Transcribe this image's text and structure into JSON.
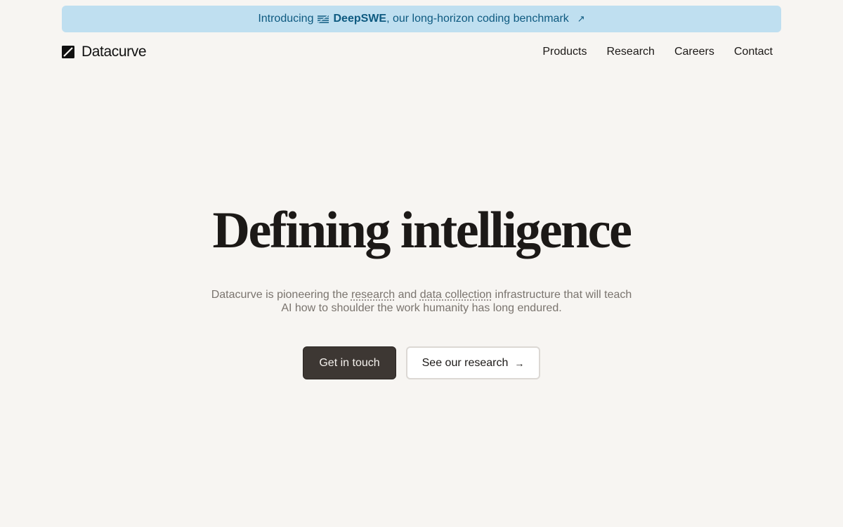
{
  "announcement": {
    "prefix": "Introducing",
    "brand": "DeepSWE",
    "suffix": ", our long-horizon coding benchmark",
    "arrow": "↗"
  },
  "nav": {
    "logo_text": "Datacurve",
    "links": [
      "Products",
      "Research",
      "Careers",
      "Contact"
    ]
  },
  "hero": {
    "title": "Defining intelligence",
    "sub_1": "Datacurve is pioneering the ",
    "sub_link_research": "research",
    "sub_2": " and ",
    "sub_link_data": "data collection",
    "sub_3": " infrastructure that will teach AI how to shoulder the work humanity has long endured.",
    "primary_button": "Get in touch",
    "secondary_button": "See our research",
    "secondary_arrow": "→"
  },
  "colors": {
    "background": "#f7f5f2",
    "announcement_bg": "#bfdff0",
    "announcement_text": "#0e5a80",
    "primary_button_bg": "#3d3733",
    "text": "#1c1917",
    "muted_text": "#7a746e"
  }
}
